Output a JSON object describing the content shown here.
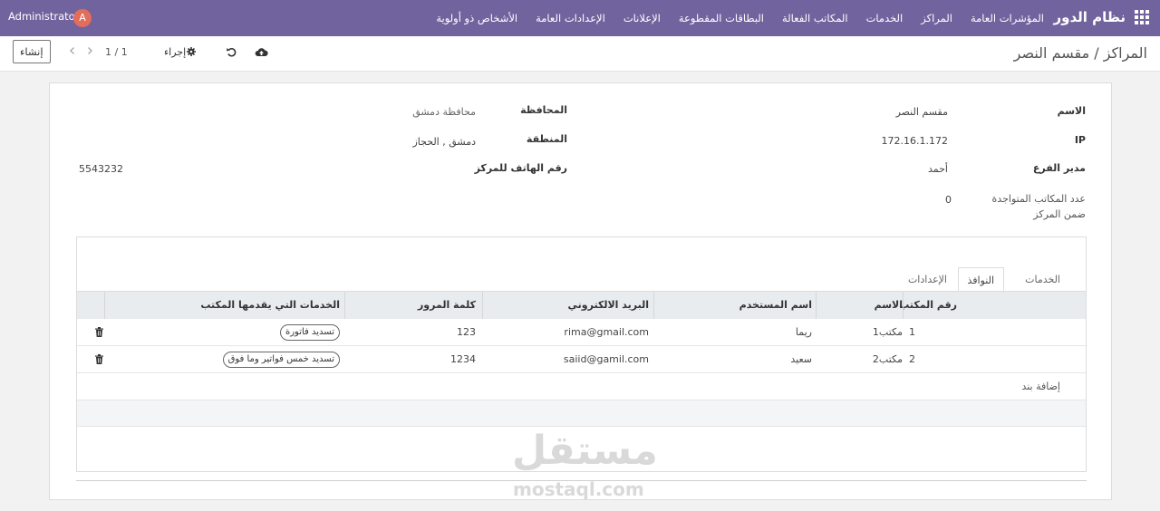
{
  "navbar": {
    "brand": "نظام الدور",
    "menu": [
      "المؤشرات العامة",
      "المراكز",
      "الخدمات",
      "المكاتب الفعالة",
      "البطاقات المقطوعة",
      "الإعلانات",
      "الإعدادات العامة",
      "الأشخاص ذو أولوية"
    ],
    "user": "Administrator",
    "avatar_letter": "A",
    "color": "#71639e",
    "avatar_color": "#e26d5b"
  },
  "control": {
    "create_label": "إنشاء",
    "pager": "1 / 1",
    "action_label": "إجراء",
    "breadcrumb": "المراكز / مقسم النصر"
  },
  "form": {
    "name_label": "الاسم",
    "name_value": "مقسم النصر",
    "ip_label": "IP",
    "ip_value": "172.16.1.172",
    "manager_label": "مدير الفرع",
    "manager_value": "أحمد",
    "offices_label_1": "عدد المكاتب المتواجدة",
    "offices_label_2": "ضمن المركز",
    "offices_value": "0",
    "governorate_label": "المحافظة",
    "governorate_value": "محافظة دمشق",
    "region_label": "المنطقة",
    "region_value": "دمشق , الحجاز",
    "phone_label": "رقم الهاتف للمركز",
    "phone_value": "5543232"
  },
  "notebook": {
    "tabs": [
      "الخدمات",
      "النوافذ",
      "الإعدادات"
    ],
    "active_tab": "النوافذ",
    "columns": [
      "رقم المكتب",
      "الاسم",
      "اسم المستخدم",
      "البريد الالكتروني",
      "كلمة المرور",
      "الخدمات التي يقدمها المكتب"
    ],
    "rows": [
      {
        "number": "1",
        "name": "مكتب1",
        "username": "ريما",
        "email": "rima@gmail.com",
        "password": "123",
        "service": "تسديد فاتورة"
      },
      {
        "number": "2",
        "name": "مكتب2",
        "username": "سعيد",
        "email": "saiid@gamil.com",
        "password": "1234",
        "service": "تسديد خمس فواتير وما فوق"
      }
    ],
    "add_line": "إضافة بند"
  },
  "watermark": {
    "arabic": "مستقل",
    "latin": "mostaql.com"
  },
  "icons": {
    "apps": "apps-grid-icon",
    "prev": "chevron-left-icon",
    "next": "chevron-right-icon",
    "gear": "gear-icon",
    "discard": "undo-icon",
    "save": "cloud-upload-icon",
    "delete": "trash-icon"
  }
}
